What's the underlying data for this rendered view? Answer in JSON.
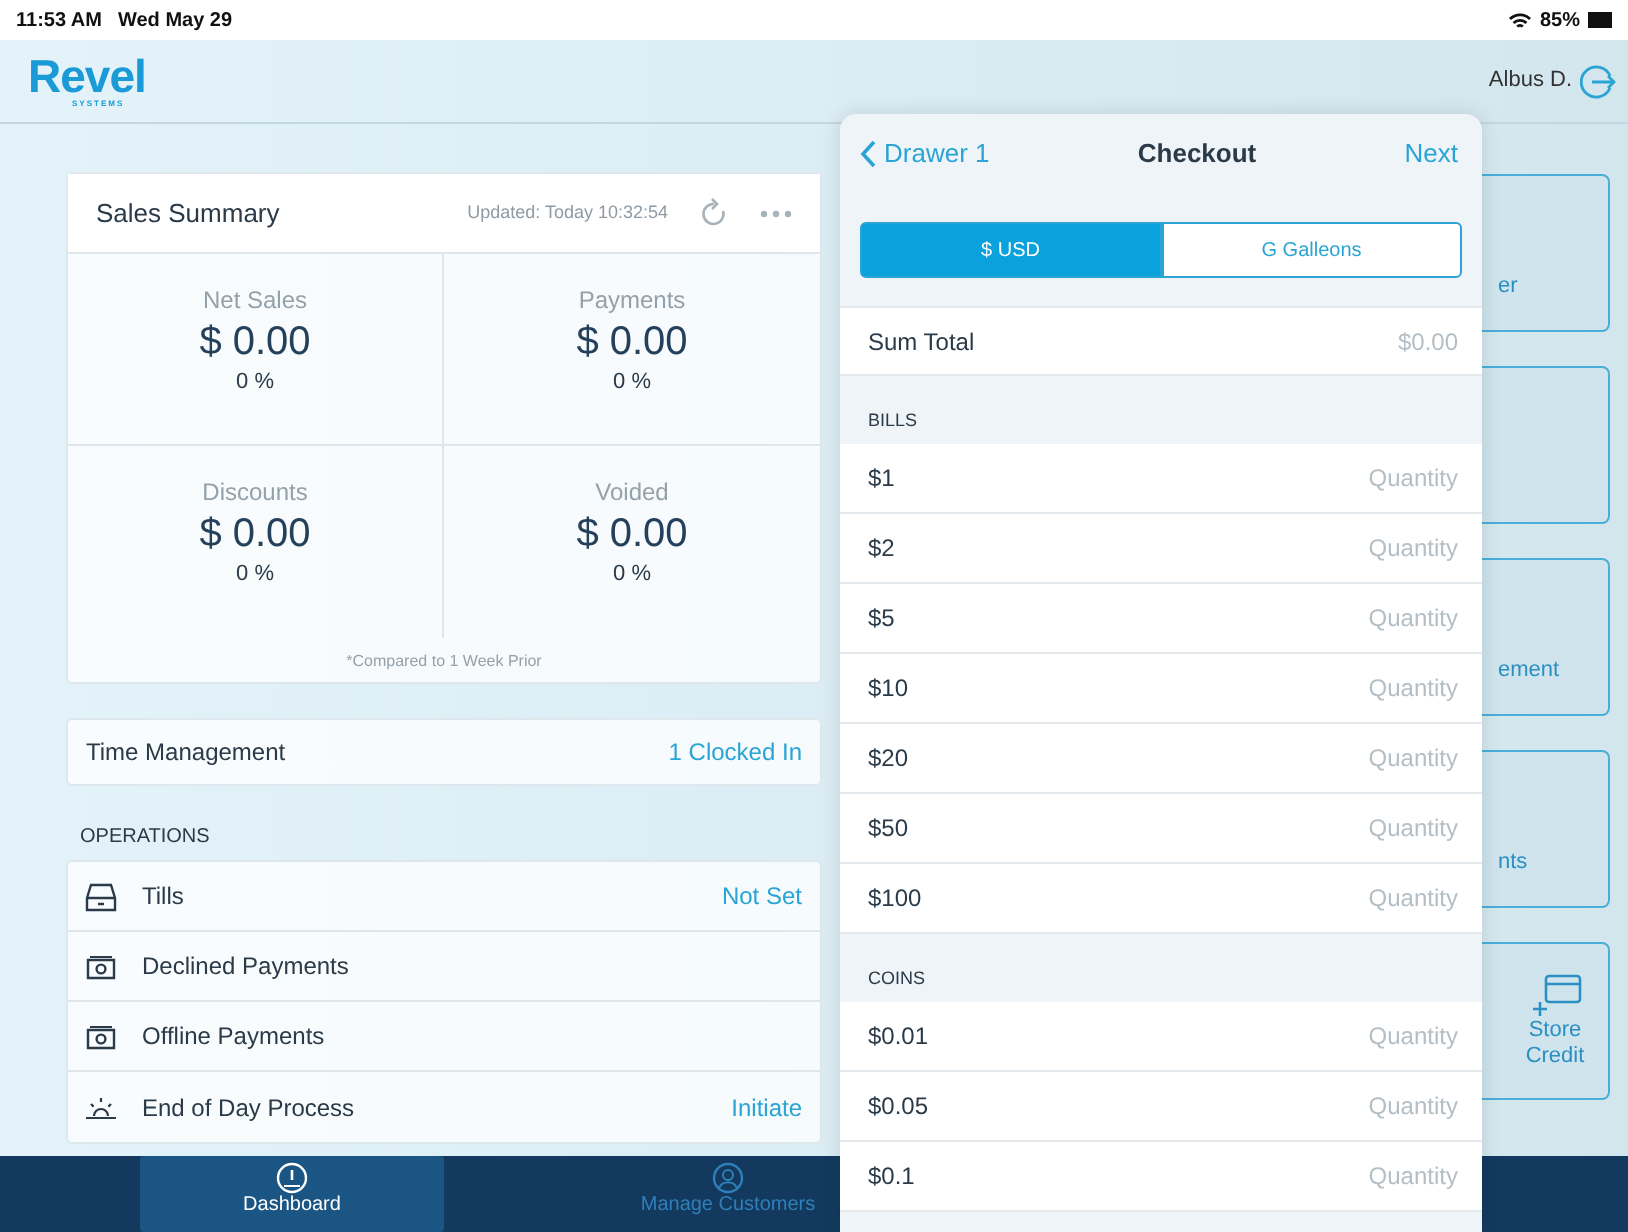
{
  "status_bar": {
    "time": "11:53 AM",
    "date": "Wed May 29",
    "battery": "85%"
  },
  "header": {
    "logo": "Revel",
    "logo_sub": "SYSTEMS",
    "user": "Albus D."
  },
  "sales_summary": {
    "title": "Sales Summary",
    "updated": "Updated: Today 10:32:54",
    "metrics": [
      {
        "label": "Net Sales",
        "value": "$ 0.00",
        "change": "0 %"
      },
      {
        "label": "Payments",
        "value": "$ 0.00",
        "change": "0 %"
      },
      {
        "label": "Discounts",
        "value": "$ 0.00",
        "change": "0 %"
      },
      {
        "label": "Voided",
        "value": "$ 0.00",
        "change": "0 %"
      }
    ],
    "footnote": "*Compared to 1 Week Prior"
  },
  "time_management": {
    "label": "Time Management",
    "value": "1 Clocked In"
  },
  "operations": {
    "heading": "OPERATIONS",
    "items": [
      {
        "label": "Tills",
        "value": "Not Set"
      },
      {
        "label": "Declined Payments"
      },
      {
        "label": "Offline Payments"
      },
      {
        "label": "End of Day Process",
        "value": "Initiate"
      }
    ]
  },
  "tiles": [
    {
      "kind": "text",
      "label": "er"
    },
    {
      "kind": "blank"
    },
    {
      "kind": "text",
      "label": "ement"
    },
    {
      "kind": "text",
      "label": "nts"
    },
    {
      "kind": "icon",
      "label": "Store Credit"
    }
  ],
  "checkout": {
    "back": "Drawer 1",
    "title": "Checkout",
    "next": "Next",
    "currencies": [
      {
        "label": "$ USD",
        "selected": true
      },
      {
        "label": "G Galleons",
        "selected": false
      }
    ],
    "sum_label": "Sum Total",
    "sum_value": "$0.00",
    "sections": [
      {
        "heading": "BILLS",
        "rows": [
          {
            "denomination": "$1",
            "placeholder": "Quantity"
          },
          {
            "denomination": "$2",
            "placeholder": "Quantity"
          },
          {
            "denomination": "$5",
            "placeholder": "Quantity"
          },
          {
            "denomination": "$10",
            "placeholder": "Quantity"
          },
          {
            "denomination": "$20",
            "placeholder": "Quantity"
          },
          {
            "denomination": "$50",
            "placeholder": "Quantity"
          },
          {
            "denomination": "$100",
            "placeholder": "Quantity"
          }
        ]
      },
      {
        "heading": "COINS",
        "rows": [
          {
            "denomination": "$0.01",
            "placeholder": "Quantity"
          },
          {
            "denomination": "$0.05",
            "placeholder": "Quantity"
          },
          {
            "denomination": "$0.1",
            "placeholder": "Quantity"
          }
        ]
      }
    ]
  },
  "tabs": [
    {
      "label": "Dashboard",
      "selected": true
    },
    {
      "label": "Manage Customers",
      "selected": false
    }
  ]
}
